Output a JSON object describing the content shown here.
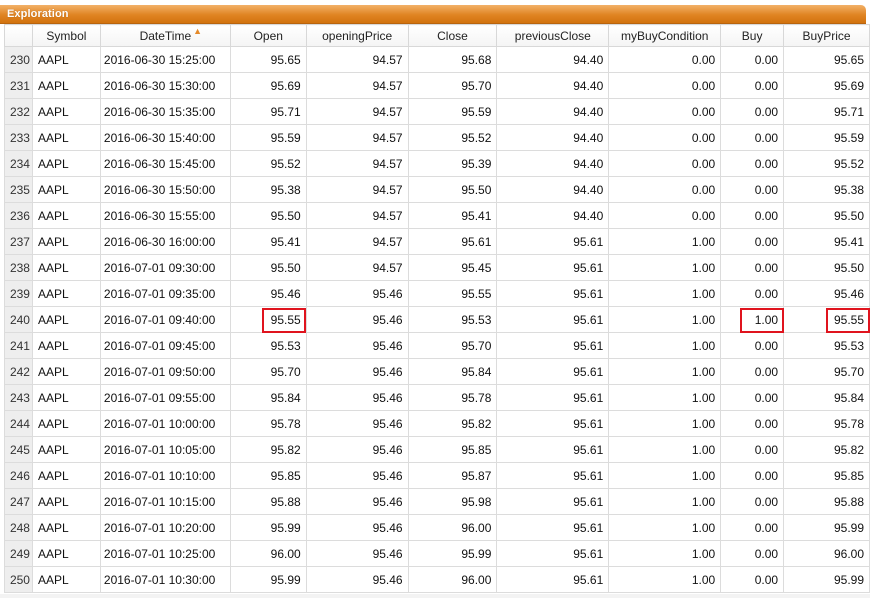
{
  "window": {
    "title": "Exploration"
  },
  "table": {
    "sort_indicator": "▲",
    "columns": [
      "Symbol",
      "DateTime",
      "Open",
      "openingPrice",
      "Close",
      "previousClose",
      "myBuyCondition",
      "Buy",
      "BuyPrice"
    ],
    "rows": [
      {
        "n": "230",
        "sym": "AAPL",
        "dt": "2016-06-30 15:25:00",
        "open": "95.65",
        "op": "94.57",
        "close": "95.68",
        "pc": "94.40",
        "cond": "0.00",
        "buy": "0.00",
        "bp": "95.65"
      },
      {
        "n": "231",
        "sym": "AAPL",
        "dt": "2016-06-30 15:30:00",
        "open": "95.69",
        "op": "94.57",
        "close": "95.70",
        "pc": "94.40",
        "cond": "0.00",
        "buy": "0.00",
        "bp": "95.69"
      },
      {
        "n": "232",
        "sym": "AAPL",
        "dt": "2016-06-30 15:35:00",
        "open": "95.71",
        "op": "94.57",
        "close": "95.59",
        "pc": "94.40",
        "cond": "0.00",
        "buy": "0.00",
        "bp": "95.71"
      },
      {
        "n": "233",
        "sym": "AAPL",
        "dt": "2016-06-30 15:40:00",
        "open": "95.59",
        "op": "94.57",
        "close": "95.52",
        "pc": "94.40",
        "cond": "0.00",
        "buy": "0.00",
        "bp": "95.59"
      },
      {
        "n": "234",
        "sym": "AAPL",
        "dt": "2016-06-30 15:45:00",
        "open": "95.52",
        "op": "94.57",
        "close": "95.39",
        "pc": "94.40",
        "cond": "0.00",
        "buy": "0.00",
        "bp": "95.52"
      },
      {
        "n": "235",
        "sym": "AAPL",
        "dt": "2016-06-30 15:50:00",
        "open": "95.38",
        "op": "94.57",
        "close": "95.50",
        "pc": "94.40",
        "cond": "0.00",
        "buy": "0.00",
        "bp": "95.38"
      },
      {
        "n": "236",
        "sym": "AAPL",
        "dt": "2016-06-30 15:55:00",
        "open": "95.50",
        "op": "94.57",
        "close": "95.41",
        "pc": "94.40",
        "cond": "0.00",
        "buy": "0.00",
        "bp": "95.50"
      },
      {
        "n": "237",
        "sym": "AAPL",
        "dt": "2016-06-30 16:00:00",
        "open": "95.41",
        "op": "94.57",
        "close": "95.61",
        "pc": "95.61",
        "cond": "1.00",
        "buy": "0.00",
        "bp": "95.41"
      },
      {
        "n": "238",
        "sym": "AAPL",
        "dt": "2016-07-01 09:30:00",
        "open": "95.50",
        "op": "94.57",
        "close": "95.45",
        "pc": "95.61",
        "cond": "1.00",
        "buy": "0.00",
        "bp": "95.50"
      },
      {
        "n": "239",
        "sym": "AAPL",
        "dt": "2016-07-01 09:35:00",
        "open": "95.46",
        "op": "95.46",
        "close": "95.55",
        "pc": "95.61",
        "cond": "1.00",
        "buy": "0.00",
        "bp": "95.46"
      },
      {
        "n": "240",
        "sym": "AAPL",
        "dt": "2016-07-01 09:40:00",
        "open": "95.55",
        "op": "95.46",
        "close": "95.53",
        "pc": "95.61",
        "cond": "1.00",
        "buy": "1.00",
        "bp": "95.55"
      },
      {
        "n": "241",
        "sym": "AAPL",
        "dt": "2016-07-01 09:45:00",
        "open": "95.53",
        "op": "95.46",
        "close": "95.70",
        "pc": "95.61",
        "cond": "1.00",
        "buy": "0.00",
        "bp": "95.53"
      },
      {
        "n": "242",
        "sym": "AAPL",
        "dt": "2016-07-01 09:50:00",
        "open": "95.70",
        "op": "95.46",
        "close": "95.84",
        "pc": "95.61",
        "cond": "1.00",
        "buy": "0.00",
        "bp": "95.70"
      },
      {
        "n": "243",
        "sym": "AAPL",
        "dt": "2016-07-01 09:55:00",
        "open": "95.84",
        "op": "95.46",
        "close": "95.78",
        "pc": "95.61",
        "cond": "1.00",
        "buy": "0.00",
        "bp": "95.84"
      },
      {
        "n": "244",
        "sym": "AAPL",
        "dt": "2016-07-01 10:00:00",
        "open": "95.78",
        "op": "95.46",
        "close": "95.82",
        "pc": "95.61",
        "cond": "1.00",
        "buy": "0.00",
        "bp": "95.78"
      },
      {
        "n": "245",
        "sym": "AAPL",
        "dt": "2016-07-01 10:05:00",
        "open": "95.82",
        "op": "95.46",
        "close": "95.85",
        "pc": "95.61",
        "cond": "1.00",
        "buy": "0.00",
        "bp": "95.82"
      },
      {
        "n": "246",
        "sym": "AAPL",
        "dt": "2016-07-01 10:10:00",
        "open": "95.85",
        "op": "95.46",
        "close": "95.87",
        "pc": "95.61",
        "cond": "1.00",
        "buy": "0.00",
        "bp": "95.85"
      },
      {
        "n": "247",
        "sym": "AAPL",
        "dt": "2016-07-01 10:15:00",
        "open": "95.88",
        "op": "95.46",
        "close": "95.98",
        "pc": "95.61",
        "cond": "1.00",
        "buy": "0.00",
        "bp": "95.88"
      },
      {
        "n": "248",
        "sym": "AAPL",
        "dt": "2016-07-01 10:20:00",
        "open": "95.99",
        "op": "95.46",
        "close": "96.00",
        "pc": "95.61",
        "cond": "1.00",
        "buy": "0.00",
        "bp": "95.99"
      },
      {
        "n": "249",
        "sym": "AAPL",
        "dt": "2016-07-01 10:25:00",
        "open": "96.00",
        "op": "95.46",
        "close": "95.99",
        "pc": "95.61",
        "cond": "1.00",
        "buy": "0.00",
        "bp": "96.00"
      },
      {
        "n": "250",
        "sym": "AAPL",
        "dt": "2016-07-01 10:30:00",
        "open": "95.99",
        "op": "95.46",
        "close": "96.00",
        "pc": "95.61",
        "cond": "1.00",
        "buy": "0.00",
        "bp": "95.99"
      }
    ],
    "highlight": {
      "row": "240",
      "columns": [
        "Open",
        "Buy",
        "BuyPrice"
      ],
      "color": "#e0141e"
    }
  },
  "colors": {
    "titlebar": "#e08422",
    "row_index_bg": "#eeeeee",
    "grid_line": "#dcdcdc",
    "sort_arrow": "#e58a2a"
  }
}
